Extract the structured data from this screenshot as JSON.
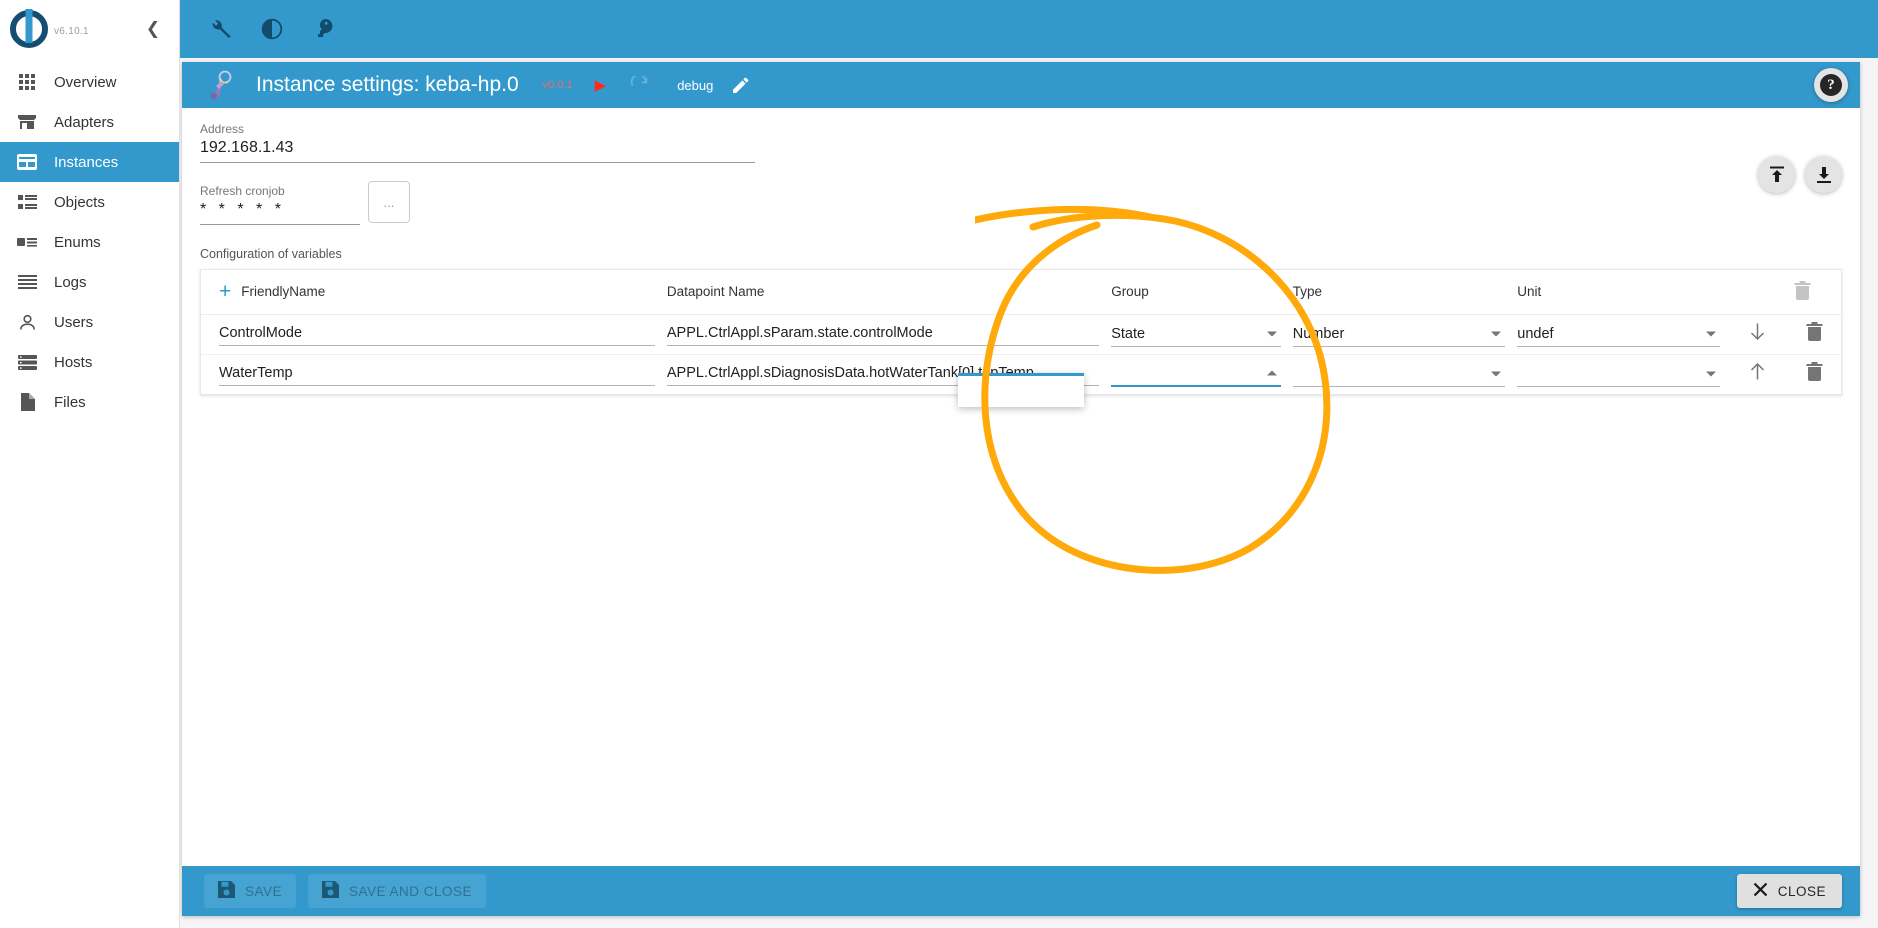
{
  "sidebar": {
    "version": "v6.10.1",
    "collapse_icon": "chevron-left-icon",
    "items": [
      {
        "label": "Overview",
        "icon": "grid-icon",
        "active": false
      },
      {
        "label": "Adapters",
        "icon": "store-icon",
        "active": false
      },
      {
        "label": "Instances",
        "icon": "instances-icon",
        "active": true
      },
      {
        "label": "Objects",
        "icon": "list-bullet-icon",
        "active": false
      },
      {
        "label": "Enums",
        "icon": "enums-icon",
        "active": false
      },
      {
        "label": "Logs",
        "icon": "lines-icon",
        "active": false
      },
      {
        "label": "Users",
        "icon": "person-icon",
        "active": false
      },
      {
        "label": "Hosts",
        "icon": "server-icon",
        "active": false
      },
      {
        "label": "Files",
        "icon": "file-icon",
        "active": false
      }
    ]
  },
  "topbar": {
    "icons": [
      "wrench-icon",
      "contrast-icon",
      "key-icon"
    ]
  },
  "card": {
    "title": "Instance settings: keba-hp.0",
    "version_badge": "v0.0.1",
    "debug_label": "debug",
    "help_label": "?",
    "icons": {
      "play": "play-icon",
      "refresh": "refresh-icon",
      "pencil": "pencil-icon",
      "upload": "upload-icon",
      "download": "download-icon"
    }
  },
  "form": {
    "address": {
      "label": "Address",
      "value": "192.168.1.43",
      "placeholder": ""
    },
    "cronjob": {
      "label": "Refresh cronjob",
      "value": "* * * * *",
      "placeholder": "",
      "dots_button": "..."
    },
    "config_caption": "Configuration of variables"
  },
  "table": {
    "add_label": "FriendlyName",
    "add_icon": "plus-icon",
    "headers": [
      "FriendlyName",
      "Datapoint Name",
      "Group",
      "Type",
      "Unit"
    ],
    "header_delete_icon": "trash-icon",
    "rows": [
      {
        "friendly_name": "ControlMode",
        "datapoint_name": "APPL.CtrlAppl.sParam.state.controlMode",
        "group": "State",
        "type": "Number",
        "unit": "undef",
        "move_icon": "arrow-down-icon",
        "delete_icon": "trash-icon",
        "group_open": false
      },
      {
        "friendly_name": "WaterTemp",
        "datapoint_name": "APPL.CtrlAppl.sDiagnosisData.hotWaterTank[0].topTemp",
        "group": "",
        "type": "",
        "unit": "",
        "move_icon": "arrow-up-icon",
        "delete_icon": "trash-icon",
        "group_open": true
      }
    ]
  },
  "actionbar": {
    "save_label": "SAVE",
    "save_close_label": "SAVE AND CLOSE",
    "close_label": "CLOSE",
    "save_icon": "floppy-icon",
    "close_icon": "close-x-icon"
  },
  "colors": {
    "accent": "#3399cc",
    "annotation": "#FFA90A",
    "sidebar_active_bg": "#3399cc",
    "play_red": "#ff2b1a"
  }
}
